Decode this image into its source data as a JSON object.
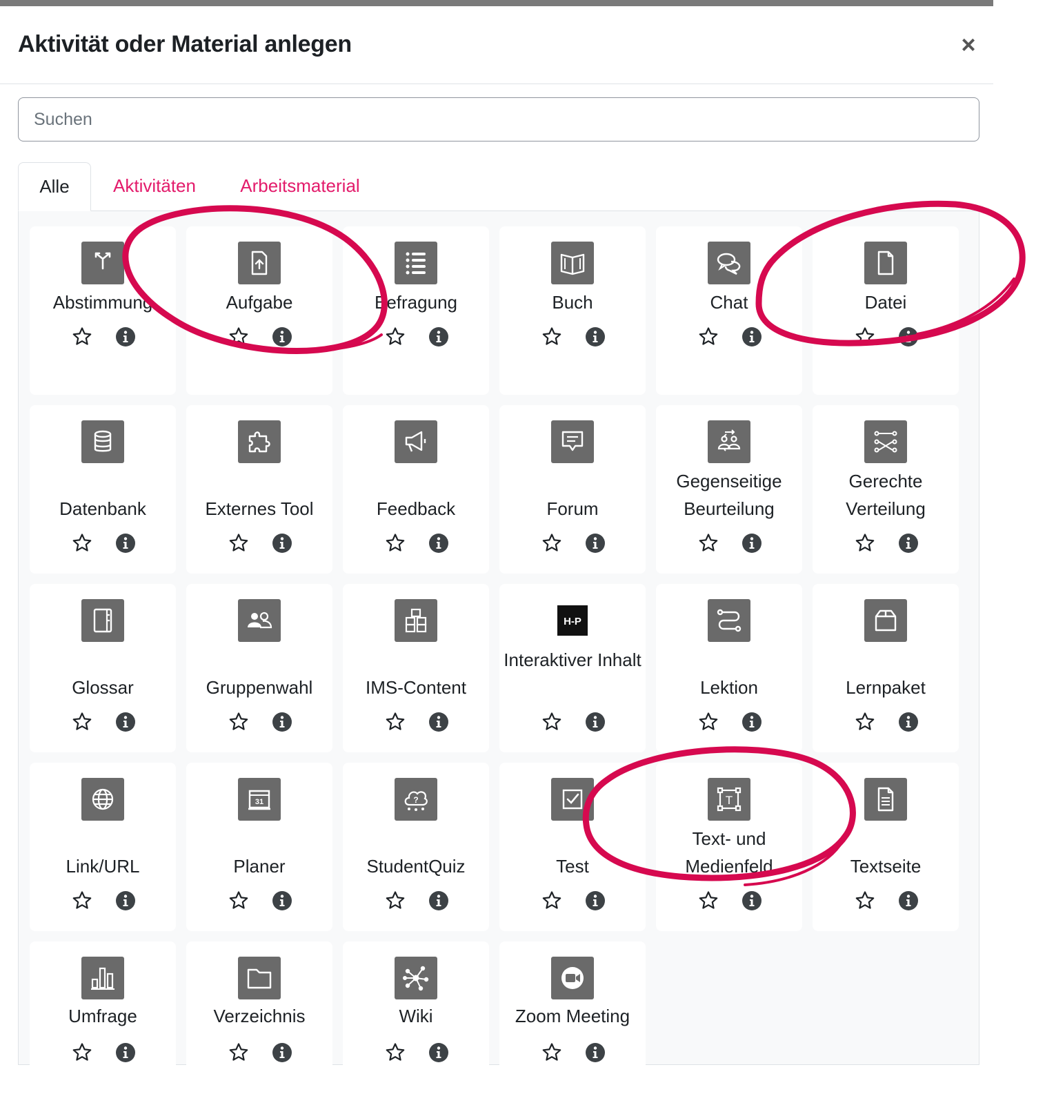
{
  "modal": {
    "title": "Aktivität oder Material anlegen",
    "close_symbol": "×"
  },
  "search": {
    "placeholder": "Suchen",
    "value": ""
  },
  "tabs": [
    {
      "label": "Alle",
      "active": true
    },
    {
      "label": "Aktivitäten",
      "active": false
    },
    {
      "label": "Arbeitsmaterial",
      "active": false
    }
  ],
  "colors": {
    "accent": "#e31b6b",
    "icon_bg": "#6a6a6a",
    "annotation": "#d6094f"
  },
  "modules": [
    {
      "label": "Abstimmung",
      "icon": "choice-icon"
    },
    {
      "label": "Aufgabe",
      "icon": "assignment-icon"
    },
    {
      "label": "Befragung",
      "icon": "questionnaire-icon"
    },
    {
      "label": "Buch",
      "icon": "book-icon"
    },
    {
      "label": "Chat",
      "icon": "chat-icon"
    },
    {
      "label": "Datei",
      "icon": "file-icon"
    },
    {
      "label": "Datenbank",
      "icon": "database-icon"
    },
    {
      "label": "Externes Tool",
      "icon": "puzzle-icon"
    },
    {
      "label": "Feedback",
      "icon": "megaphone-icon"
    },
    {
      "label": "Forum",
      "icon": "forum-icon"
    },
    {
      "label": "Gegenseitige Beurteilung",
      "icon": "workshop-icon"
    },
    {
      "label": "Gerechte Verteilung",
      "icon": "ratingallocate-icon"
    },
    {
      "label": "Glossar",
      "icon": "glossary-icon"
    },
    {
      "label": "Gruppenwahl",
      "icon": "group-choice-icon"
    },
    {
      "label": "IMS-Content",
      "icon": "ims-package-icon"
    },
    {
      "label": "Interaktiver Inhalt",
      "icon": "h5p-icon",
      "icon_text": "H-P"
    },
    {
      "label": "Lektion",
      "icon": "lesson-icon"
    },
    {
      "label": "Lernpaket",
      "icon": "scorm-package-icon"
    },
    {
      "label": "Link/URL",
      "icon": "globe-icon"
    },
    {
      "label": "Planer",
      "icon": "calendar-icon",
      "icon_text": "31"
    },
    {
      "label": "StudentQuiz",
      "icon": "studentquiz-icon"
    },
    {
      "label": "Test",
      "icon": "quiz-check-icon"
    },
    {
      "label": "Text- und Medienfeld",
      "icon": "text-media-icon",
      "icon_text": "T"
    },
    {
      "label": "Textseite",
      "icon": "page-icon"
    },
    {
      "label": "Umfrage",
      "icon": "survey-chart-icon"
    },
    {
      "label": "Verzeichnis",
      "icon": "folder-icon"
    },
    {
      "label": "Wiki",
      "icon": "wiki-icon"
    },
    {
      "label": "Zoom Meeting",
      "icon": "zoom-icon"
    }
  ]
}
